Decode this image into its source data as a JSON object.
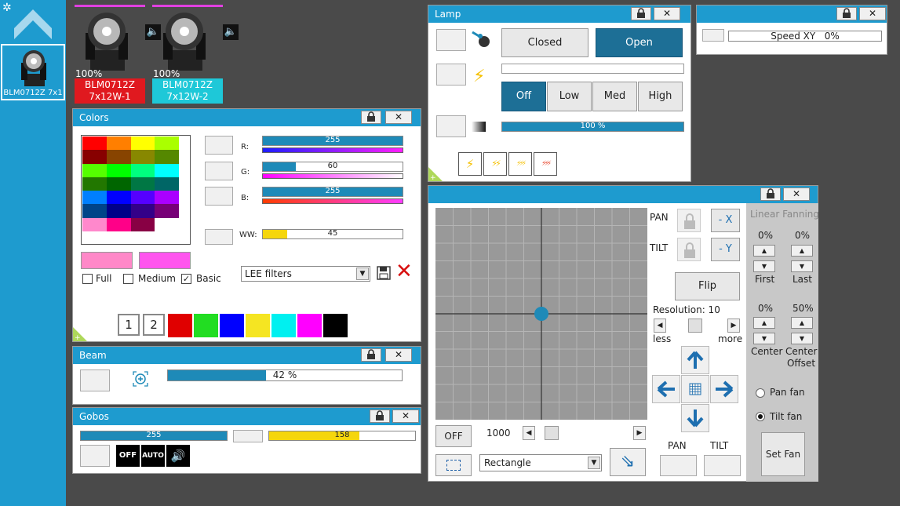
{
  "fixtures": [
    {
      "percent": "100%",
      "model": "BLM0712Z",
      "name": "7x12W-1",
      "color": "#e0191f"
    },
    {
      "percent": "100%",
      "model": "BLM0712Z",
      "name": "7x12W-2",
      "color": "#1ec8d8"
    }
  ],
  "sidebar": {
    "fixture_label": "BLM0712Z 7x1"
  },
  "lamp": {
    "title": "Lamp",
    "closed": "Closed",
    "open": "Open",
    "power_off": "Off",
    "power_low": "Low",
    "power_med": "Med",
    "power_high": "High",
    "dimmer": "100 %",
    "dimmer_value": 1.0
  },
  "speed": {
    "label": "Speed XY",
    "value": "0%"
  },
  "colors": {
    "title": "Colors",
    "r_label": "R:",
    "g_label": "G:",
    "b_label": "B:",
    "ww_label": "WW:",
    "r": "255",
    "g": "60",
    "b": "255",
    "ww": "45",
    "r_frac": 1.0,
    "g_frac": 0.235,
    "b_frac": 1.0,
    "ww_frac": 0.176,
    "full": "Full",
    "medium": "Medium",
    "basic": "Basic",
    "filter": "LEE filters",
    "preset_1": "1",
    "preset_2": "2",
    "swatch_a": "#ff88c8",
    "swatch_b": "#ff55ee",
    "grid": [
      "#ff0000",
      "#ff7f00",
      "#ffff00",
      "#aaff00",
      "#880000",
      "#884400",
      "#888800",
      "#558800",
      "#55ff00",
      "#00ff00",
      "#00ff7f",
      "#00ffff",
      "#227700",
      "#006600",
      "#007744",
      "#006666",
      "#007fff",
      "#0000ff",
      "#5500ff",
      "#aa00ff",
      "#004488",
      "#000088",
      "#330088",
      "#770077",
      "#ff88cc",
      "#ff0088",
      "#880044",
      "#ffffff"
    ],
    "quick": [
      "#e00000",
      "#22dd22",
      "#0000ff",
      "#f5e522",
      "#00f0f0",
      "#ff00ff",
      "#000000"
    ]
  },
  "beam": {
    "title": "Beam",
    "value": "42 %",
    "frac": 0.42
  },
  "gobos": {
    "title": "Gobos",
    "a": "255",
    "a_frac": 1.0,
    "b": "158",
    "b_frac": 0.62,
    "off": "OFF",
    "auto": "AUTO"
  },
  "pantilt": {
    "pan": "PAN",
    "tilt": "TILT",
    "neg_x": "- X",
    "neg_y": "- Y",
    "flip": "Flip",
    "resolution": "Resolution: 10",
    "less": "less",
    "more": "more",
    "off": "OFF",
    "speed": "1000",
    "shape": "Rectangle",
    "pan_bottom": "PAN",
    "tilt_bottom": "TILT",
    "fanning_title": "Linear Fanning",
    "first_pct": "0%",
    "last_pct": "0%",
    "first": "First",
    "last": "Last",
    "center_pct": "0%",
    "offset_pct": "50%",
    "center": "Center",
    "center_offset": "Center Offset",
    "pan_fan": "Pan fan",
    "tilt_fan": "Tilt fan",
    "set_fan": "Set Fan"
  }
}
